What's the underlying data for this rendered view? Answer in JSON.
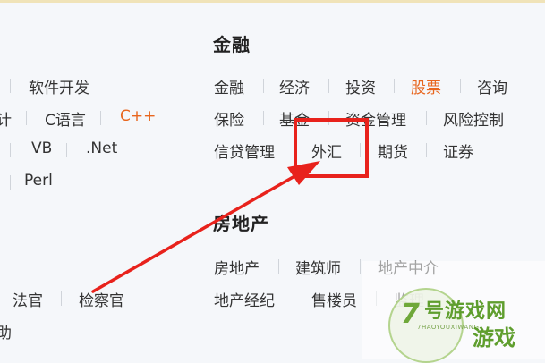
{
  "sections": {
    "finance": {
      "title": "金融"
    },
    "realestate": {
      "title": "房地产"
    }
  },
  "left": {
    "software_dev": "软件开发",
    "ji": "计",
    "c_lang": "C语言",
    "cpp": "C++",
    "vb": "VB",
    "dotnet": ".Net",
    "perl": "Perl",
    "judge": "法官",
    "prosecutor": "检察官",
    "zhu": "助"
  },
  "finance": {
    "row1": [
      "金融",
      "经济",
      "投资",
      "股票",
      "咨询"
    ],
    "row2": [
      "保险",
      "基金",
      "资金管理",
      "风险控制"
    ],
    "row3": [
      "信贷管理",
      "外汇",
      "期货",
      "证券"
    ]
  },
  "realestate": {
    "row1": [
      "房地产",
      "建筑师",
      "地产中介"
    ],
    "row2": [
      "地产经纪",
      "售楼员",
      "监理"
    ]
  },
  "watermark": {
    "seven": "7",
    "logo_top": "号游戏网",
    "logo_bottom": "游戏",
    "url": "7HAOYOUXIWANG"
  },
  "colors": {
    "highlight": "#e8661e",
    "annotation": "#e8221c"
  }
}
